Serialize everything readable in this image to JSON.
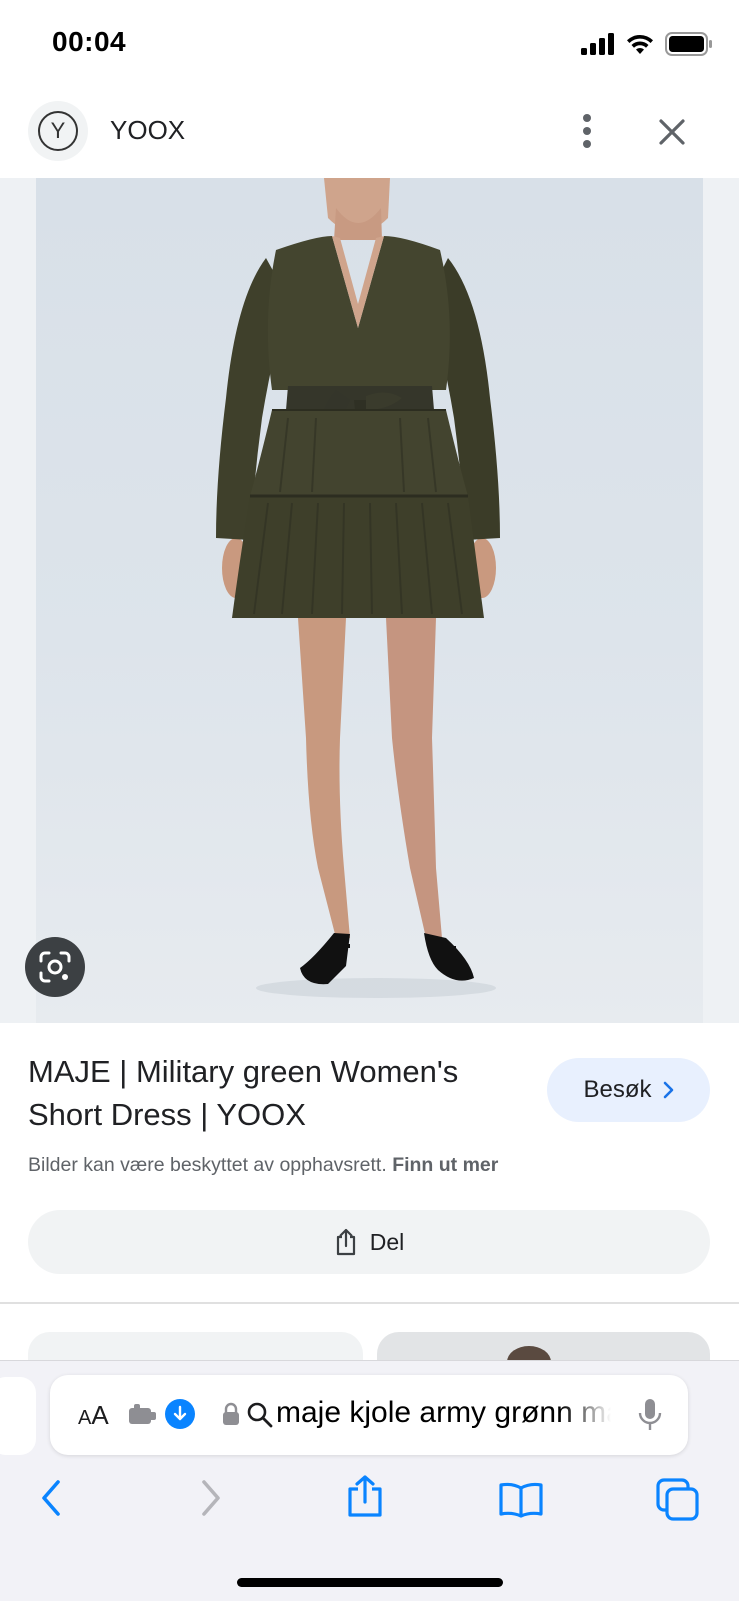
{
  "status_bar": {
    "time": "00:04"
  },
  "header": {
    "site_name": "YOOX",
    "logo_letter": "Y"
  },
  "result": {
    "title": "MAJE | Military green Women's Short Dress | YOOX",
    "visit_label": "Besøk",
    "copyright_text": "Bilder kan være beskyttet av opphavsrett.",
    "learn_more": "Finn ut mer",
    "share_label": "Del"
  },
  "address_bar": {
    "aa_label": "AA",
    "url_text": "maje kjole army grønn maje"
  },
  "icons": {
    "status": [
      "signal-icon",
      "wifi-icon",
      "battery-icon"
    ],
    "header": [
      "more-vert-icon",
      "close-icon"
    ],
    "bottom_nav": [
      "back-icon",
      "forward-icon",
      "share-icon",
      "bookmarks-icon",
      "tabs-icon"
    ]
  },
  "colors": {
    "accent": "#0a84ff",
    "visit_bg": "#e8f0fe",
    "dress": "#3e3f2a"
  }
}
